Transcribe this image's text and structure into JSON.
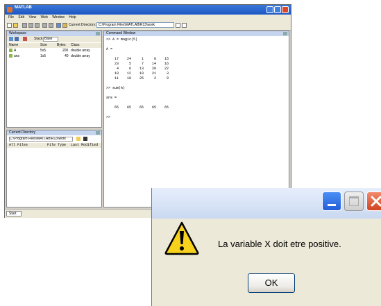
{
  "matlab": {
    "title": "MATLAB",
    "menu": [
      "File",
      "Edit",
      "View",
      "Web",
      "Window",
      "Help"
    ],
    "current_dir_label": "Current Directory:",
    "current_dir_value": "C:\\Program Files\\MATLAB\\R13\\work",
    "workspace": {
      "title": "Workspace",
      "stack_label": "Stack:",
      "stack_value": "Base",
      "columns": [
        "Name",
        "Size",
        "Bytes",
        "Class"
      ],
      "rows": [
        {
          "name": "A",
          "size": "5x5",
          "bytes": "200",
          "class": "double array"
        },
        {
          "name": "ans",
          "size": "1x5",
          "bytes": "40",
          "class": "double array"
        }
      ]
    },
    "history": {
      "title": "Current Directory",
      "path": "C:\\Program Files\\MATLAB\\R13\\work",
      "columns": [
        "All Files",
        "File Type",
        "Last Modified"
      ]
    },
    "command_window": {
      "title": "Command Window",
      "lines": [
        ">> A = magic(5)",
        "",
        "A =",
        "",
        "    17    24     1     8    15",
        "    23     5     7    14    16",
        "     4     6    13    20    22",
        "    10    12    19    21     3",
        "    11    18    25     2     9",
        "",
        ">> sum(A)",
        "",
        "ans =",
        "",
        "    65    65    65    65    65",
        "",
        ">>"
      ]
    },
    "start_label": "Start"
  },
  "dialog": {
    "message": "La variable X doit etre positive.",
    "ok_label": "OK"
  }
}
